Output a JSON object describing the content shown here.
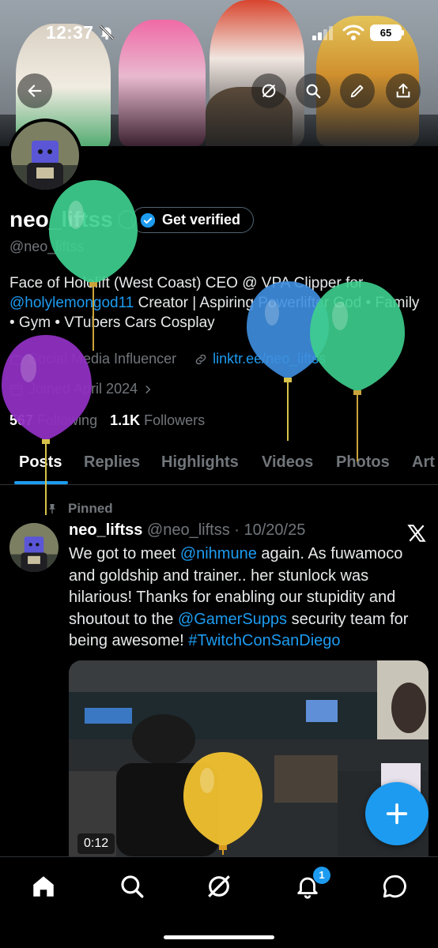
{
  "status_bar": {
    "time": "12:37",
    "battery": "65"
  },
  "profile": {
    "display_name": "neo_liftss",
    "verify_label": "Get verified",
    "handle": "@neo_liftss",
    "bio_part1": "Face of Hololift (West Coast) CEO @ VPA Clipper for ",
    "bio_mention": "@holylemongod11",
    "bio_part2": " Creator | Aspiring Powerlifter God • Family • Gym • VTubers Cars Cosplay",
    "category": "Social Media Influencer",
    "link": "linktr.ee/neo_liftss",
    "joined": "Joined April 2024",
    "following_count": "567",
    "following_label": "Following",
    "followers_count": "1.1K",
    "followers_label": "Followers"
  },
  "tabs": [
    "Posts",
    "Replies",
    "Highlights",
    "Videos",
    "Photos",
    "Art"
  ],
  "post": {
    "pinned_label": "Pinned",
    "name": "neo_liftss",
    "handle_date": "@neo_liftss · 10/20/25",
    "text_part1": "We got to meet ",
    "mention1": "@nihmune",
    "text_part2": " again. As fuwamoco and goldship and trainer.. her stunlock was hilarious! Thanks for enabling our stupidity and shoutout to the ",
    "mention2": "@GamerSupps",
    "text_part3": " security team for being awesome! ",
    "hashtag": "#TwitchConSanDiego",
    "video_duration": "0:12"
  },
  "bottom_nav": {
    "notification_count": "1"
  },
  "colors": {
    "accent": "#1d9bf0",
    "background": "#000000",
    "secondary_text": "#71767b",
    "balloon_green": "#3ecf8e",
    "balloon_purple": "#8e2fc0",
    "balloon_blue": "#3f8fe0",
    "balloon_yellow": "#f2c230"
  },
  "icons": [
    "back-arrow-icon",
    "grok-icon",
    "search-icon",
    "edit-icon",
    "share-icon",
    "verified-check-icon",
    "briefcase-icon",
    "link-icon",
    "calendar-icon",
    "chevron-right-icon",
    "pin-icon",
    "x-logo-icon",
    "plus-icon",
    "home-icon",
    "bell-icon",
    "messages-icon"
  ]
}
